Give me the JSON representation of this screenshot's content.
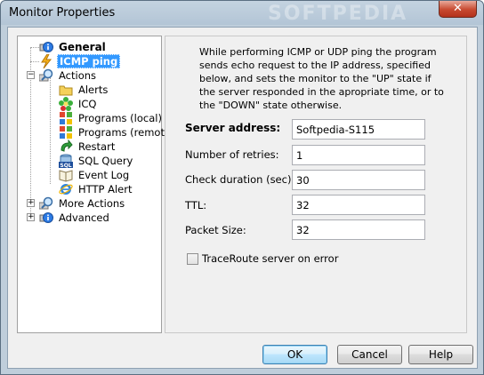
{
  "window": {
    "title": "Monitor Properties",
    "watermark": "SOFTPEDIA",
    "close_glyph": "✕"
  },
  "tree": {
    "items": [
      {
        "label": "General",
        "icon": "info-icon",
        "bold": true
      },
      {
        "label": "ICMP ping",
        "icon": "lightning-icon",
        "selected": true
      },
      {
        "label": "Actions",
        "icon": "magnifier-icon"
      },
      {
        "label": "Alerts",
        "icon": "folder-icon"
      },
      {
        "label": "ICQ",
        "icon": "icq-flower-icon"
      },
      {
        "label": "Programs (local)",
        "icon": "windows-icon"
      },
      {
        "label": "Programs (remote)",
        "icon": "windows-icon"
      },
      {
        "label": "Restart",
        "icon": "restart-arrow-icon"
      },
      {
        "label": "SQL Query",
        "icon": "sql-icon"
      },
      {
        "label": "Event Log",
        "icon": "book-icon"
      },
      {
        "label": "HTTP Alert",
        "icon": "ie-icon"
      },
      {
        "label": "More Actions",
        "icon": "magnifier-icon"
      },
      {
        "label": "Advanced",
        "icon": "info-icon"
      }
    ]
  },
  "panel": {
    "description": "While performing ICMP or UDP ping the program sends echo request to the IP address, specified below, and sets the monitor to the \"UP\" state if the server responded in the apropriate time, or to the \"DOWN\" state otherwise.",
    "fields": {
      "server_address": {
        "label": "Server address:",
        "value": "Softpedia-S115"
      },
      "retries": {
        "label": "Number of retries:",
        "value": "1"
      },
      "check_duration": {
        "label": "Check duration (sec):",
        "value": "30"
      },
      "ttl": {
        "label": "TTL:",
        "value": "32"
      },
      "packet_size": {
        "label": "Packet Size:",
        "value": "32"
      }
    },
    "traceroute": {
      "label": "TraceRoute server on error",
      "checked": false
    }
  },
  "buttons": {
    "ok": "OK",
    "cancel": "Cancel",
    "help": "Help"
  }
}
